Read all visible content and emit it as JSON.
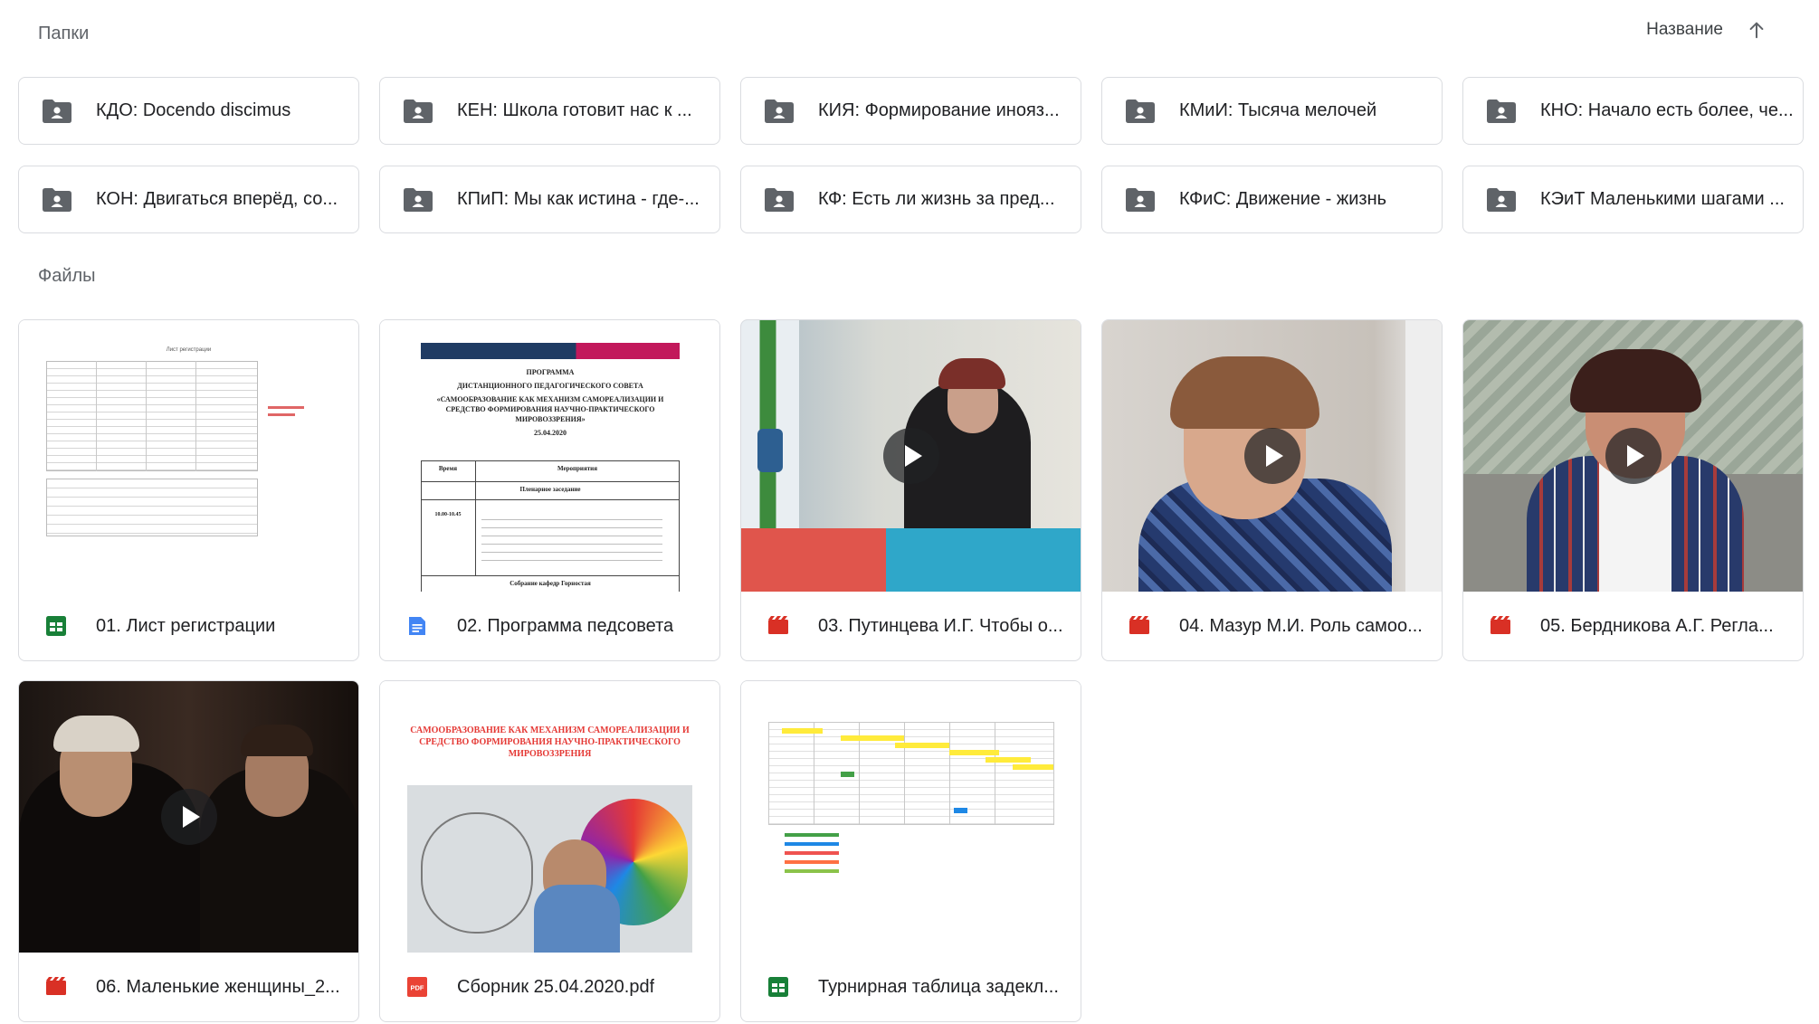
{
  "sections": {
    "folders_label": "Папки",
    "files_label": "Файлы"
  },
  "sort": {
    "label": "Название",
    "direction_icon": "arrow-up-icon"
  },
  "folders": [
    {
      "name": "КДО: Docendo discimus"
    },
    {
      "name": "КЕН: Школа готовит нас к ..."
    },
    {
      "name": "КИЯ: Формирование инояз..."
    },
    {
      "name": "КМиИ: Тысяча мелочей"
    },
    {
      "name": "КНО: Начало есть более, че..."
    },
    {
      "name": "КОН: Двигаться вперёд, со..."
    },
    {
      "name": "КПиП: Мы как истина - где-..."
    },
    {
      "name": "КФ: Есть ли жизнь за пред..."
    },
    {
      "name": "КФиС: Движение - жизнь"
    },
    {
      "name": "КЭиТ Маленькими шагами ..."
    }
  ],
  "files": [
    {
      "name": "01. Лист регистрации",
      "type": "sheets"
    },
    {
      "name": "02. Программа педсовета",
      "type": "docs"
    },
    {
      "name": "03. Путинцева И.Г. Чтобы о...",
      "type": "video"
    },
    {
      "name": "04. Мазур М.И. Роль самоо...",
      "type": "video"
    },
    {
      "name": "05. Бердникова А.Г. Регла...",
      "type": "video"
    },
    {
      "name": "06. Маленькие женщины_2...",
      "type": "video"
    },
    {
      "name": "Сборник 25.04.2020.pdf",
      "type": "pdf"
    },
    {
      "name": "Турнирная таблица задекл...",
      "type": "sheets"
    }
  ],
  "thumbs": {
    "doc_heading": "ПРОГРАММА",
    "doc_subheading": "ДИСТАНЦИОННОГО ПЕДАГОГИЧЕСКОГО СОВЕТА",
    "doc_title": "«САМООБРАЗОВАНИЕ КАК МЕХАНИЗМ САМОРЕАЛИЗАЦИИ И СРЕДСТВО ФОРМИРОВАНИЯ НАУЧНО-ПРАКТИЧЕСКОГО МИРОВОЗЗРЕНИЯ»",
    "doc_date": "25.04.2020",
    "doc_col_time": "Время",
    "doc_col_events": "Мероприятия",
    "doc_session": "Пленарное заседание",
    "doc_time_range": "10.00-10.45",
    "doc_footer": "Собрание кафедр Горностая",
    "pdf_title": "САМООБРАЗОВАНИЕ КАК МЕХАНИЗМ САМОРЕАЛИЗАЦИИ И СРЕДСТВО ФОРМИРОВАНИЯ НАУЧНО-ПРАКТИЧЕСКОГО МИРОВОЗЗРЕНИЯ",
    "sheet_title": "Лист регистрации"
  },
  "colors": {
    "video_red": "#d93025",
    "sheets_green": "#188038",
    "docs_blue": "#4285f4",
    "folder_gray": "#5f6368",
    "pdf_red": "#ea4335"
  }
}
